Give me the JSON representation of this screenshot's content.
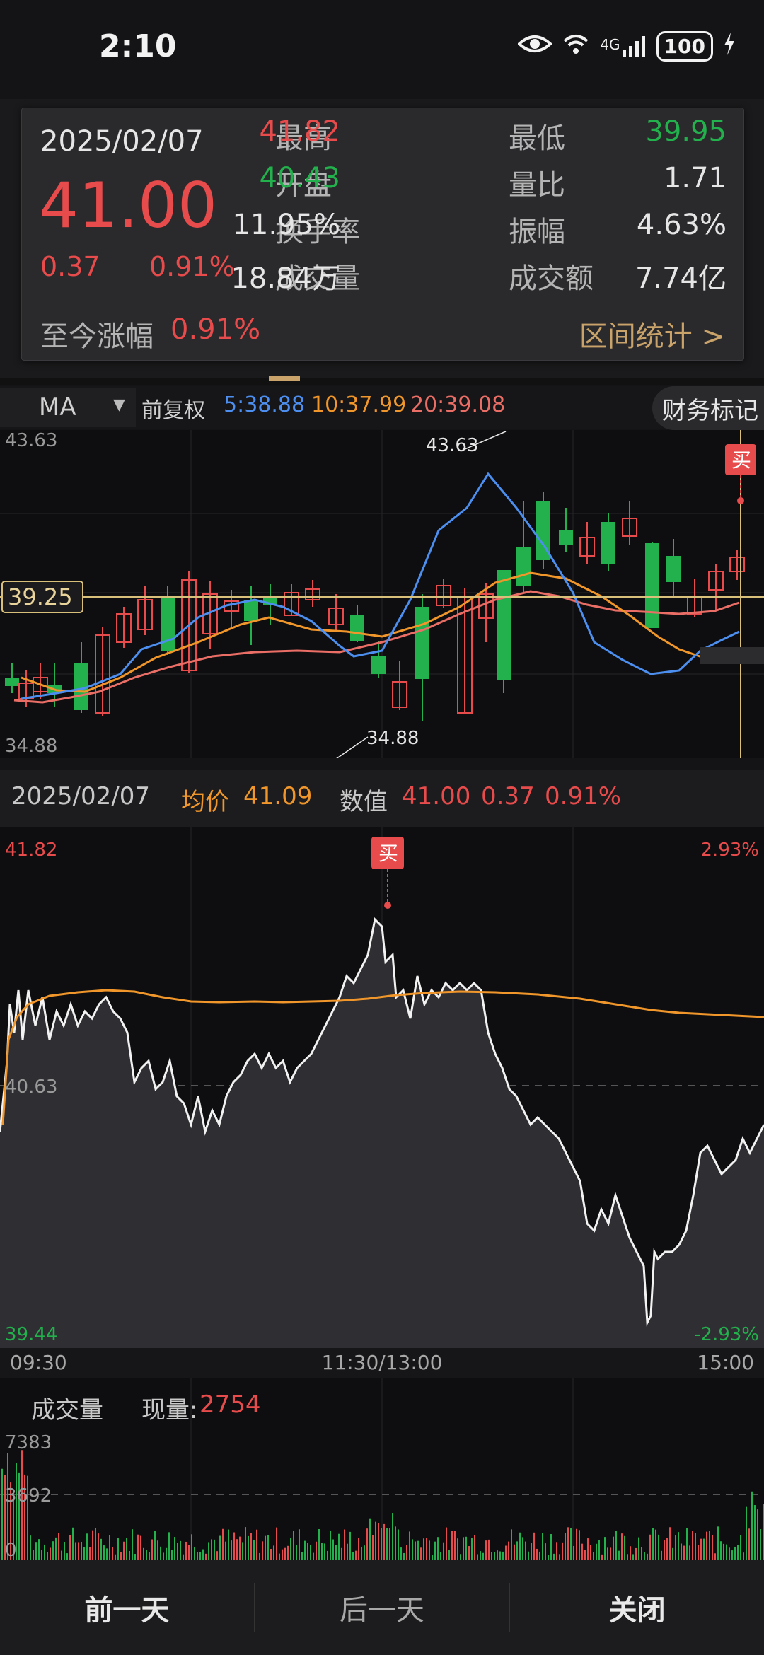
{
  "status_bar": {
    "time": "2:10",
    "battery": "100",
    "network": "4G"
  },
  "info_card": {
    "date": "2025/02/07",
    "price": "41.00",
    "change": "0.37",
    "change_pct": "0.91%",
    "fields": [
      {
        "label": "最高",
        "value": "41.82",
        "color": "#e84b4b"
      },
      {
        "label": "最低",
        "value": "39.95",
        "color": "#22b14c"
      },
      {
        "label": "开盘",
        "value": "40.43",
        "color": "#22b14c"
      },
      {
        "label": "量比",
        "value": "1.71",
        "color": "#e6e6e6"
      },
      {
        "label": "换手率",
        "value": "11.95%",
        "color": "#e6e6e6"
      },
      {
        "label": "振幅",
        "value": "4.63%",
        "color": "#e6e6e6"
      },
      {
        "label": "成交量",
        "value": "18.84万",
        "color": "#e6e6e6"
      },
      {
        "label": "成交额",
        "value": "7.74亿",
        "color": "#e6e6e6"
      }
    ],
    "since_label": "至今涨幅",
    "since_value": "0.91%",
    "range_link": "区间统计 >"
  },
  "ma_bar": {
    "selector": "MA",
    "adjust": "前复权",
    "ma5": "5:38.88",
    "ma10": "10:37.99",
    "ma20": "20:39.08",
    "finance_mark": "财务标记"
  },
  "kline": {
    "y_top": "43.63",
    "y_bottom": "34.88",
    "crosshair_label": "39.25",
    "high_label": "43.63",
    "low_label": "34.88",
    "buy_tag": "买"
  },
  "intraday": {
    "date": "2025/02/07",
    "avg_label": "均价",
    "avg_value": "41.09",
    "value_label": "数值",
    "value": "41.00",
    "change": "0.37",
    "change_pct": "0.91%",
    "y_top": "41.82",
    "y_mid": "40.63",
    "y_bottom": "39.44",
    "pct_top": "2.93%",
    "pct_bottom": "-2.93%",
    "t_start": "09:30",
    "t_mid": "11:30/13:00",
    "t_end": "15:00",
    "buy_tag": "买"
  },
  "volume": {
    "label": "成交量",
    "now_label": "现量:",
    "now_value": "2754",
    "y_top": "7383",
    "y_mid": "3692",
    "y_bottom": "0"
  },
  "bottom_bar": {
    "prev": "前一天",
    "next": "后一天",
    "close": "关闭"
  },
  "colors": {
    "up": "#e84b4b",
    "down": "#22b14c",
    "accent": "#c9a36a",
    "ma5": "#4c8ff0",
    "ma10": "#f0962a",
    "ma20": "#ea6e66"
  }
}
